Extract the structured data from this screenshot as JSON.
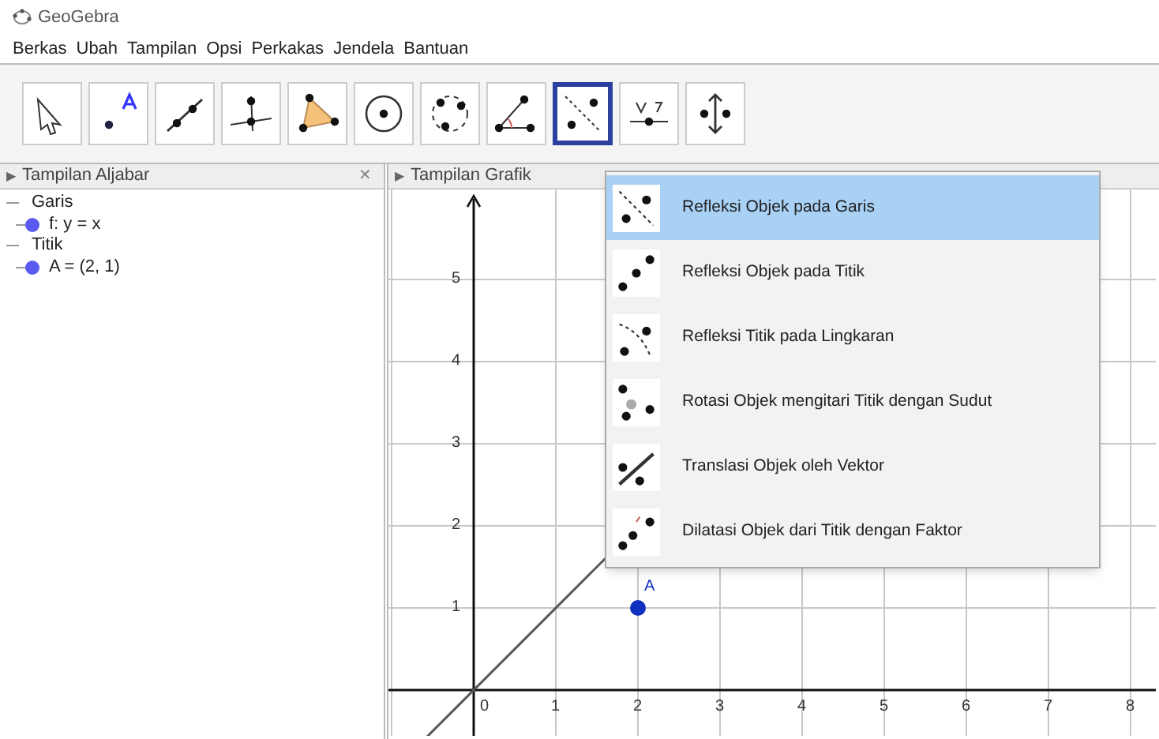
{
  "window": {
    "title": "GeoGebra"
  },
  "menu": [
    "Berkas",
    "Ubah",
    "Tampilan",
    "Opsi",
    "Perkakas",
    "Jendela",
    "Bantuan"
  ],
  "toolbar": [
    {
      "selected": false
    },
    {
      "selected": false
    },
    {
      "selected": false
    },
    {
      "selected": false
    },
    {
      "selected": false
    },
    {
      "selected": false
    },
    {
      "selected": false
    },
    {
      "selected": false
    },
    {
      "selected": true
    },
    {
      "selected": false
    },
    {
      "selected": false
    }
  ],
  "algebra_view": {
    "toggle": "▶",
    "title": "Tampilan Aljabar",
    "close": "✕",
    "groups": [
      {
        "label": "Garis",
        "expanded": true,
        "items": [
          "f: y = x"
        ]
      },
      {
        "label": "Titik",
        "expanded": true,
        "items": [
          "A = (2, 1)"
        ]
      }
    ]
  },
  "graphics_view": {
    "toggle": "▶",
    "title": "Tampilan Grafik",
    "x_ticks": [
      "0",
      "1",
      "2",
      "3",
      "4",
      "5",
      "6",
      "7",
      "8"
    ],
    "y_ticks": [
      "5",
      "4",
      "3",
      "2",
      "1"
    ],
    "point_label": "A"
  },
  "dropdown": [
    {
      "label": "Refleksi Objek pada Garis",
      "selected": true
    },
    {
      "label": "Refleksi Objek pada Titik",
      "selected": false
    },
    {
      "label": "Refleksi Titik pada Lingkaran",
      "selected": false
    },
    {
      "label": "Rotasi Objek mengitari Titik dengan Sudut",
      "selected": false
    },
    {
      "label": "Translasi Objek oleh Vektor",
      "selected": false
    },
    {
      "label": "Dilatasi Objek dari Titik dengan Faktor",
      "selected": false
    }
  ]
}
